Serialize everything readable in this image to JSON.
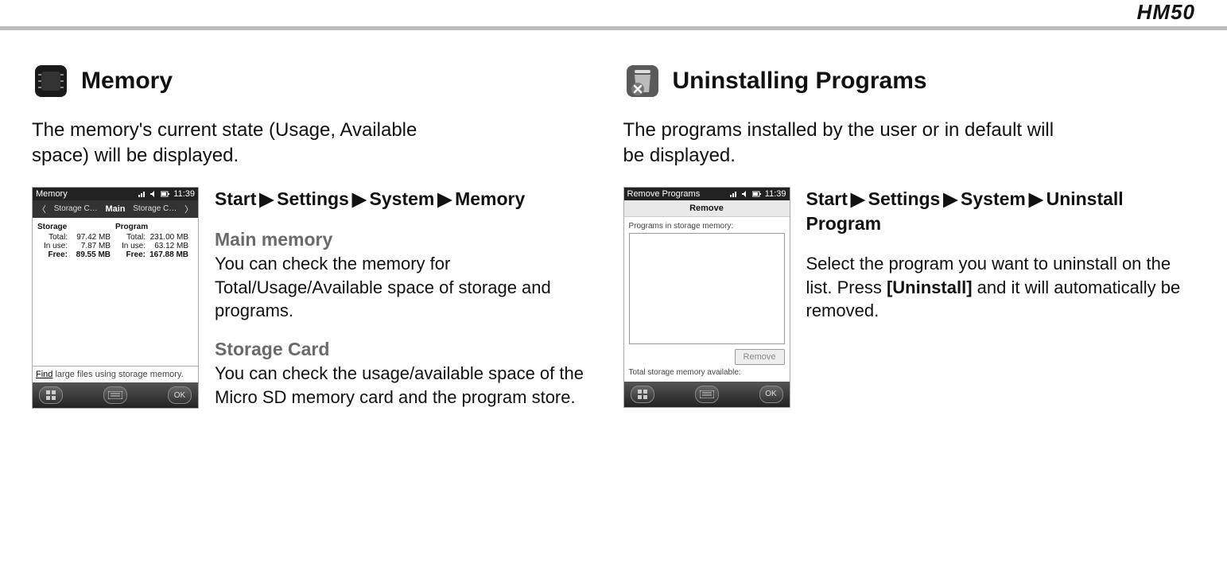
{
  "header": {
    "model": "HM50"
  },
  "left": {
    "title": "Memory",
    "intro": "The memory's current state (Usage, Available space) will be displayed.",
    "path": [
      "Start",
      "Settings",
      "System",
      "Memory"
    ],
    "sub1_title": "Main memory",
    "sub1_body": "You can check the memory for Total/Usage/Available space of storage and programs.",
    "sub2_title": "Storage Card",
    "sub2_body": "You can check the usage/available space of the Micro SD memory card and the program store.",
    "screenshot": {
      "title": "Memory",
      "time": "11:39",
      "tab_left": "Storage C…",
      "tab_center": "Main",
      "tab_right": "Storage C…",
      "storage": {
        "header": "Storage",
        "total_label": "Total:",
        "total": "97.42 MB",
        "inuse_label": "In use:",
        "inuse": "7.87 MB",
        "free_label": "Free:",
        "free": "89.55 MB"
      },
      "program": {
        "header": "Program",
        "total_label": "Total:",
        "total": "231.00 MB",
        "inuse_label": "In use:",
        "inuse": "63.12 MB",
        "free_label": "Free:",
        "free": "167.88 MB"
      },
      "find_link": "Find",
      "find_text": " large files using storage memory.",
      "ok": "OK"
    }
  },
  "right": {
    "title": "Uninstalling Programs",
    "intro": "The programs installed by the user or in default will be displayed.",
    "path": [
      "Start",
      "Settings",
      "System",
      "Uninstall Program"
    ],
    "body1": "Select the program you want to uninstall on the list. Press ",
    "body_bold": "[Uninstall]",
    "body2": " and it will automatically be removed.",
    "screenshot": {
      "title": "Remove Programs",
      "time": "11:39",
      "subtitle": "Remove",
      "list_label": "Programs in storage memory:",
      "remove_btn": "Remove",
      "avail": "Total storage memory available:",
      "ok": "OK"
    }
  }
}
